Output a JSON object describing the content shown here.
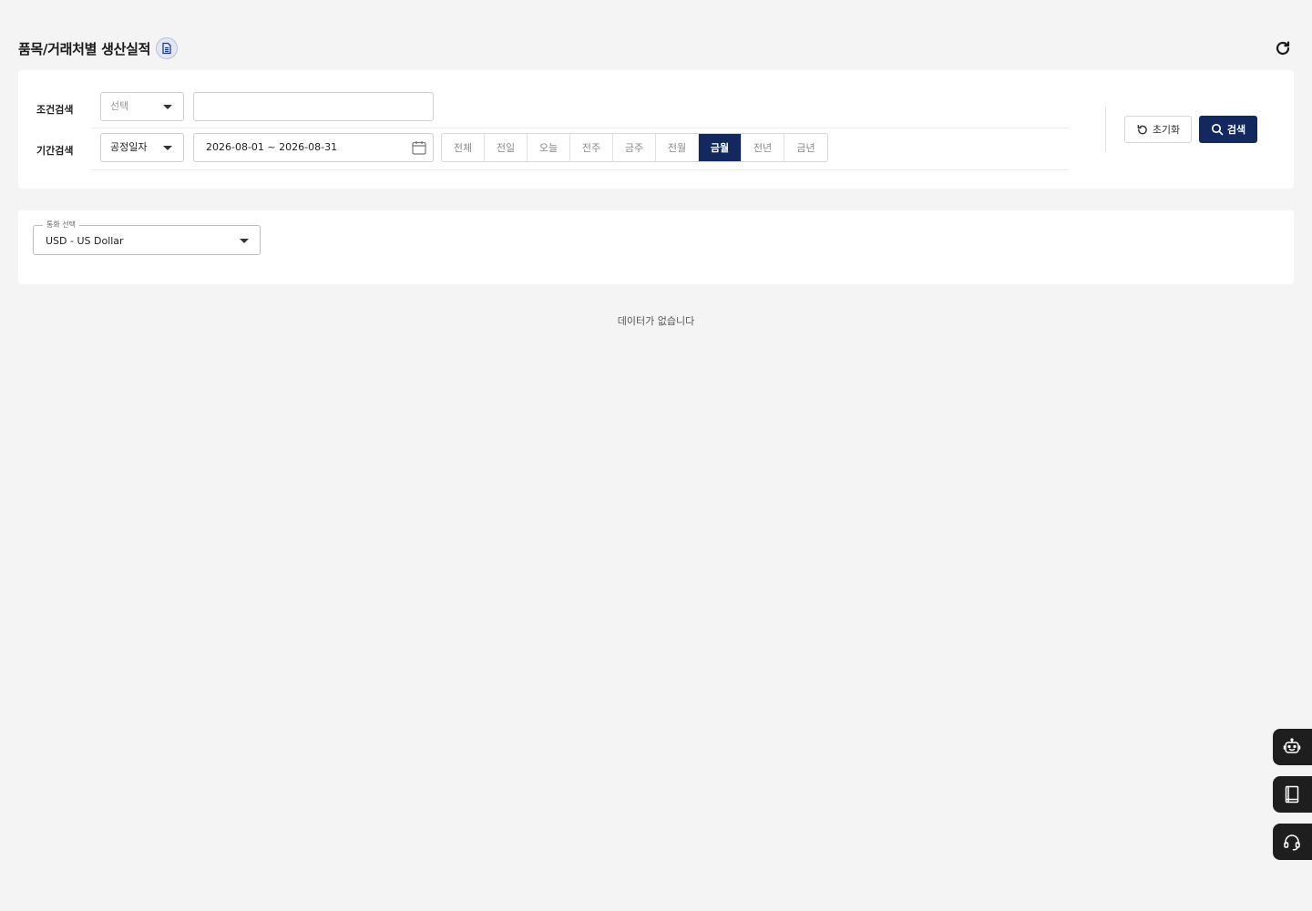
{
  "header": {
    "title": "품목/거래처별 생산실적",
    "doc_icon": "document-icon",
    "refresh_icon": "refresh-icon"
  },
  "search": {
    "condition_label": "조건검색",
    "condition_select_value": "선택",
    "condition_input_value": "",
    "period_label": "기간검색",
    "period_select_value": "공정일자",
    "date_range": "2026-08-01 ~ 2026-08-31",
    "period_buttons": [
      "전체",
      "전일",
      "오늘",
      "전주",
      "금주",
      "전월",
      "금월",
      "전년",
      "금년"
    ],
    "active_period": "금월",
    "reset_label": "초기화",
    "search_label": "검색"
  },
  "currency": {
    "label": "통화 선택",
    "value": "USD - US Dollar"
  },
  "empty_message": "데이터가 없습니다",
  "floating": {
    "items": [
      "robot-assistant-icon",
      "manual-book-icon",
      "headset-support-icon"
    ]
  },
  "colors": {
    "primary": "#12285e",
    "background": "#f4f4f4",
    "floating": "#1e1e1e"
  }
}
